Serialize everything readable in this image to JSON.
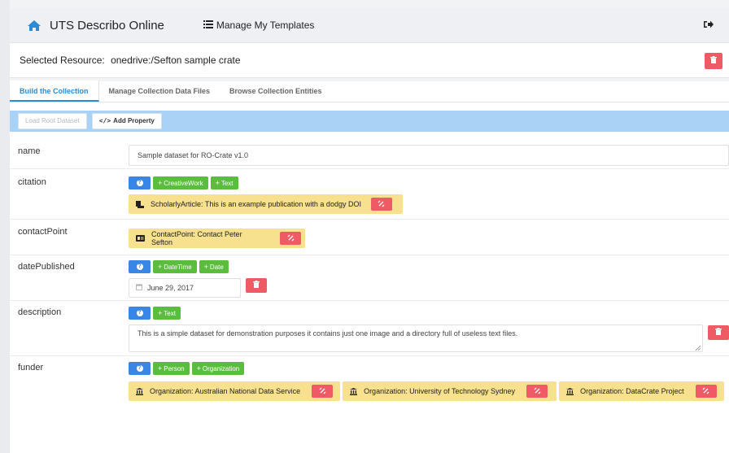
{
  "navbar": {
    "title": "UTS Describo Online",
    "templates_label": "Manage My Templates",
    "home_icon": "home-icon",
    "logout_icon": "sign-out-icon"
  },
  "resource": {
    "label": "Selected Resource:",
    "value": "onedrive:/Sefton sample crate"
  },
  "tabs": [
    {
      "label": "Build the Collection",
      "active": true
    },
    {
      "label": "Manage Collection Data Files",
      "active": false
    },
    {
      "label": "Browse Collection Entities",
      "active": false
    }
  ],
  "toolbar": {
    "load_root": "Load Root Dataset",
    "add_property": "Add Property"
  },
  "properties": {
    "name": {
      "label": "name",
      "value": "Sample dataset for RO-Crate v1.0"
    },
    "citation": {
      "label": "citation",
      "buttons": [
        "CreativeWork",
        "Text"
      ],
      "entities": [
        "ScholarlyArticle: This is an example publication with a dodgy DOI"
      ]
    },
    "contactPoint": {
      "label": "contactPoint",
      "entities": [
        "ContactPoint: Contact Peter Sefton"
      ]
    },
    "datePublished": {
      "label": "datePublished",
      "buttons": [
        "DateTime",
        "Date"
      ],
      "value": "June 29, 2017"
    },
    "description": {
      "label": "description",
      "buttons": [
        "Text"
      ],
      "value": "This is a simple dataset for demonstration purposes it contains just one image and a directory full of useless text files."
    },
    "funder": {
      "label": "funder",
      "buttons": [
        "Person",
        "Organization"
      ],
      "entities": [
        "Organization: Australian National Data Service",
        "Organization: University of Technology Sydney",
        "Organization: DataCrate Project"
      ]
    }
  },
  "colors": {
    "primary": "#3a86e4",
    "success": "#5bbd3e",
    "danger": "#ef5b65",
    "entity": "#f7e18f",
    "toolbar": "#aad2f6",
    "tab_active": "#2c8bd6"
  }
}
